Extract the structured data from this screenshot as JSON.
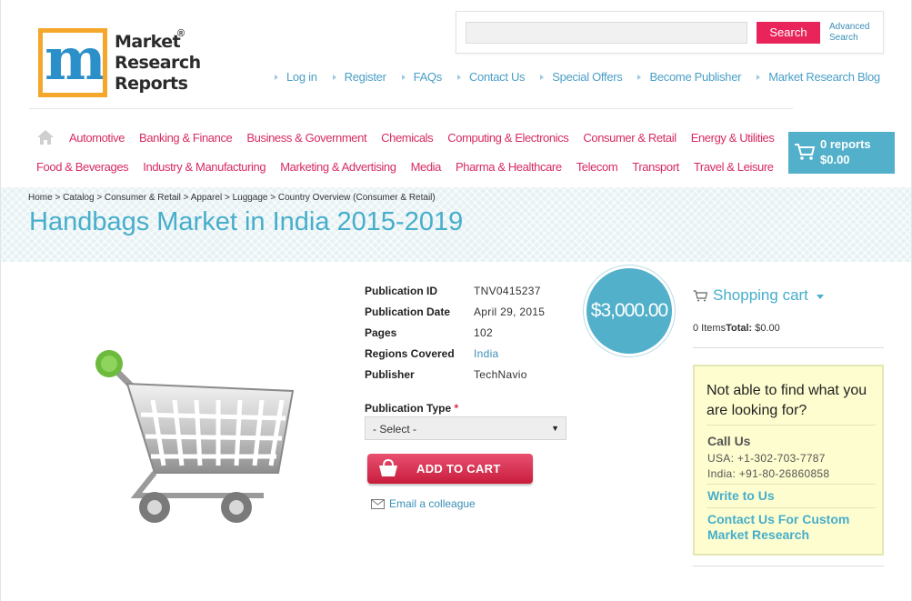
{
  "brand": {
    "name_line1": "Market",
    "name_line2": "Research",
    "name_line3": "Reports",
    "registered": "®",
    "logo_letter": "m"
  },
  "search": {
    "value": "",
    "placeholder": "",
    "button_label": "Search",
    "advanced_line1": "Advanced",
    "advanced_line2": "Search"
  },
  "top_links": [
    "Log in",
    "Register",
    "FAQs",
    "Contact Us",
    "Special Offers",
    "Become Publisher",
    "Market Research Blog"
  ],
  "categories_row1": [
    "Automotive",
    "Banking & Finance",
    "Business & Government",
    "Chemicals",
    "Computing & Electronics",
    "Consumer & Retail",
    "Energy & Utilities"
  ],
  "categories_row2": [
    "Food & Beverages",
    "Industry & Manufacturing",
    "Marketing & Advertising",
    "Media",
    "Pharma & Healthcare",
    "Telecom",
    "Transport",
    "Travel & Leisure"
  ],
  "cart_button": {
    "reports": "0 reports",
    "total": "$0.00"
  },
  "breadcrumb": "Home > Catalog > Consumer & Retail > Apparel > Luggage > Country Overview (Consumer & Retail)",
  "page_title": "Handbags Market in India 2015-2019",
  "details": {
    "publication_id_label": "Publication ID",
    "publication_id": "TNV0415237",
    "publication_date_label": "Publication Date",
    "publication_date": "April 29, 2015",
    "pages_label": "Pages",
    "pages": "102",
    "regions_label": "Regions Covered",
    "regions": "India",
    "publisher_label": "Publisher",
    "publisher": "TechNavio"
  },
  "publication_type": {
    "label": "Publication Type",
    "required_mark": "*",
    "selected": "- Select -"
  },
  "add_to_cart_label": "ADD TO CART",
  "email_colleague": "Email a colleague",
  "price": "$3,000.00",
  "shopping_cart": {
    "title": "Shopping cart",
    "items": "0 Items",
    "total_label": "Total:",
    "total": "$0.00"
  },
  "help": {
    "title": "Not able to find what you are looking for?",
    "call_us": "Call Us",
    "phone_usa": "USA: +1-302-703-7787",
    "phone_india": "India: +91-80-26860858",
    "write_to_us": "Write to Us",
    "custom_research": "Contact Us For Custom Market Research"
  },
  "colors": {
    "accent_blue": "#47aecb",
    "brand_pink": "#d72b61",
    "search_button": "#e8245a",
    "help_box_bg": "#fefdcf"
  }
}
